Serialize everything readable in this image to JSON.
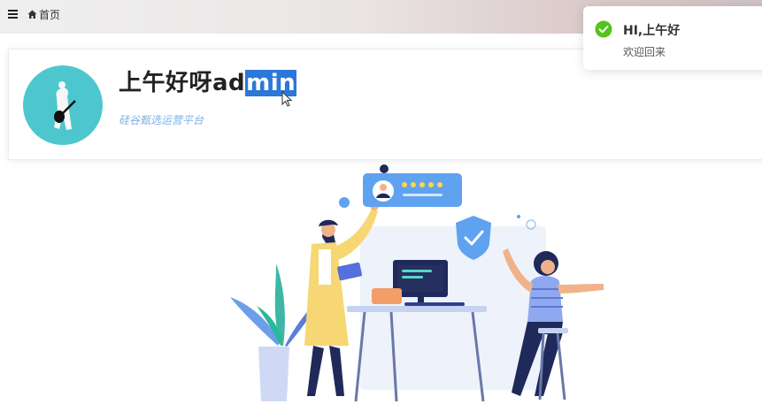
{
  "header": {
    "breadcrumb": "首页"
  },
  "welcome": {
    "greeting_prefix": "上午好呀ad",
    "greeting_selected": "min",
    "subtitle": "硅谷甄选运营平台"
  },
  "toast": {
    "title": "HI,上午好",
    "message": "欢迎回来",
    "status": "success"
  },
  "colors": {
    "selection": "#2b78d8",
    "subtitle": "#7fb2e8",
    "avatar_bg": "#4dc7cd",
    "success": "#52c41a"
  }
}
